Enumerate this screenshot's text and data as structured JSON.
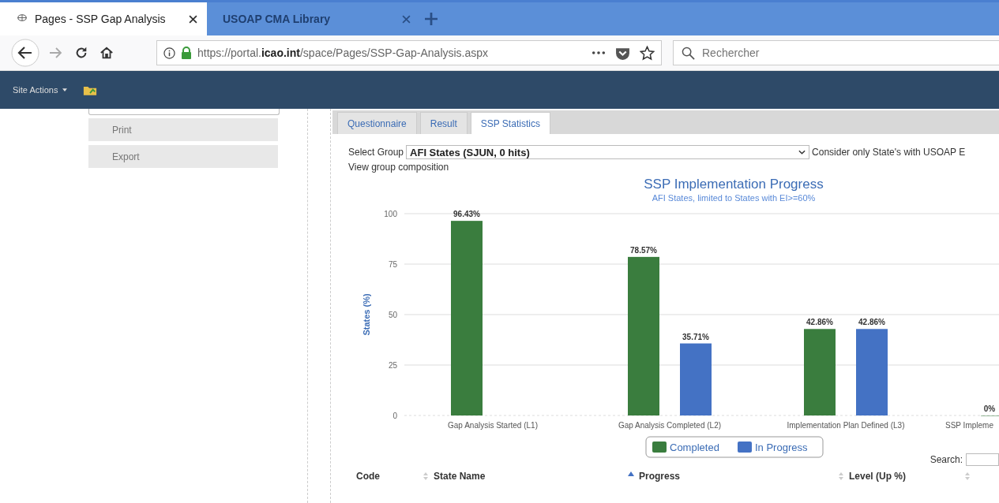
{
  "browser_tabs": [
    {
      "title": "Pages - SSP Gap Analysis",
      "selected": true
    },
    {
      "title": "USOAP CMA Library",
      "selected": false
    }
  ],
  "address_bar": {
    "url": "https://portal.**icao.int**/space/Pages/SSP-Gap-Analysis.aspx"
  },
  "search_field": {
    "placeholder": "Rechercher"
  },
  "site_actions": "Site Actions",
  "sidebar": {
    "items": [
      "Print",
      "Export"
    ]
  },
  "page_tabs": [
    {
      "label": "Questionnaire",
      "selected": false
    },
    {
      "label": "Result",
      "selected": false
    },
    {
      "label": "SSP Statistics",
      "selected": true
    }
  ],
  "select_group": {
    "label": "Select Group",
    "value": "AFI States (SJUN, 0 hits)"
  },
  "consider_text": "Consider only State's with USOAP E",
  "view_group_link": "View group composition",
  "chart": {
    "chart_data": {
      "type": "bar",
      "title": "SSP Implementation Progress",
      "subtitle": "AFI States, limited to States with EI>=60%",
      "ylabel": "States (%)",
      "categories": [
        "Gap Analysis Started (L1)",
        "Gap Analysis Completed (L2)",
        "Implementation Plan Defined (L3)",
        "SSP Impleme"
      ],
      "ylim": [
        0,
        100
      ],
      "yticks": [
        0,
        25,
        50,
        75,
        100
      ],
      "data_labels": true,
      "grid": true,
      "legend": true,
      "series": [
        {
          "name": "Completed",
          "color": "#3a7d3e",
          "values": [
            96.43,
            78.57,
            42.86,
            0
          ],
          "value_labels": [
            "96.43%",
            "78.57%",
            "42.86%",
            "0%"
          ]
        },
        {
          "name": "In Progress",
          "color": "#4472c4",
          "values": [
            null,
            35.71,
            42.86,
            null
          ],
          "value_labels": [
            null,
            "35.71%",
            "42.86%",
            null
          ]
        }
      ]
    }
  },
  "table": {
    "search_label": "Search:",
    "columns": [
      {
        "label": "Code",
        "sorted": false
      },
      {
        "label": "State Name",
        "sorted": true
      },
      {
        "label": "Progress",
        "sorted": false
      },
      {
        "label": "Level (Up %)",
        "sorted": false
      }
    ]
  }
}
